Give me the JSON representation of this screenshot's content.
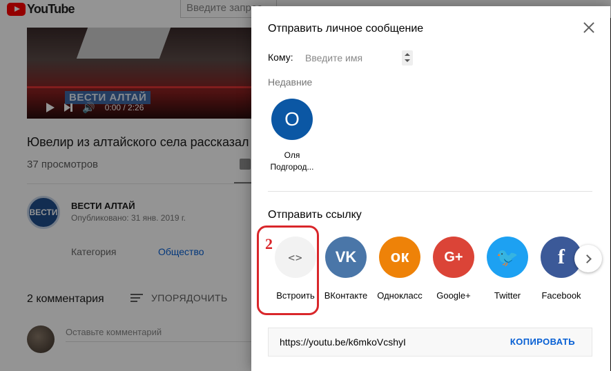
{
  "background": {
    "logo_text": "YouTube",
    "search_placeholder": "Введите запрос",
    "video_time": "0:00 / 2:26",
    "video_watermark": "ВЕСТИ АЛТАЙ",
    "video_title": "Ювелир из алтайского села рассказал",
    "views": "37 просмотров",
    "channel": {
      "avatar_text": "ВЕСТИ",
      "name": "ВЕСТИ АЛТАЙ",
      "published": "Опубликовано: 31 янв. 2019 г."
    },
    "category_label": "Категория",
    "category_value": "Общество",
    "comments_count": "2 комментария",
    "sort_label": "УПОРЯДОЧИТЬ",
    "comment_placeholder": "Оставьте комментарий"
  },
  "dialog": {
    "title": "Отправить личное сообщение",
    "to_label": "Кому:",
    "to_placeholder": "Введите имя",
    "recent_label": "Недавние",
    "recent_contacts": [
      {
        "initial": "О",
        "name": "Оля Подгород...",
        "color": "#0b57a4"
      }
    ],
    "send_link_label": "Отправить ссылку",
    "share_targets": [
      {
        "icon": "embed-code-icon",
        "glyph": "<>",
        "label": "Встроить",
        "color": "#f2f2f2"
      },
      {
        "icon": "vk-icon",
        "glyph": "VK",
        "label": "ВКонтакте",
        "color": "#4a76a8"
      },
      {
        "icon": "odnoklassniki-icon",
        "glyph": "ок",
        "label": "Однокласс",
        "color": "#ee8208"
      },
      {
        "icon": "google-plus-icon",
        "glyph": "G+",
        "label": "Google+",
        "color": "#db4437"
      },
      {
        "icon": "twitter-icon",
        "glyph": "🐦",
        "label": "Twitter",
        "color": "#1da1f2"
      },
      {
        "icon": "facebook-icon",
        "glyph": "f",
        "label": "Facebook",
        "color": "#3b5998"
      }
    ],
    "annotation_number": "2",
    "share_url": "https://youtu.be/k6mkoVcshyI",
    "copy_label": "КОПИРОВАТЬ"
  },
  "colors": {
    "accent": "#065fd4",
    "annotation": "#d9262a",
    "brand": "#ff0000"
  }
}
